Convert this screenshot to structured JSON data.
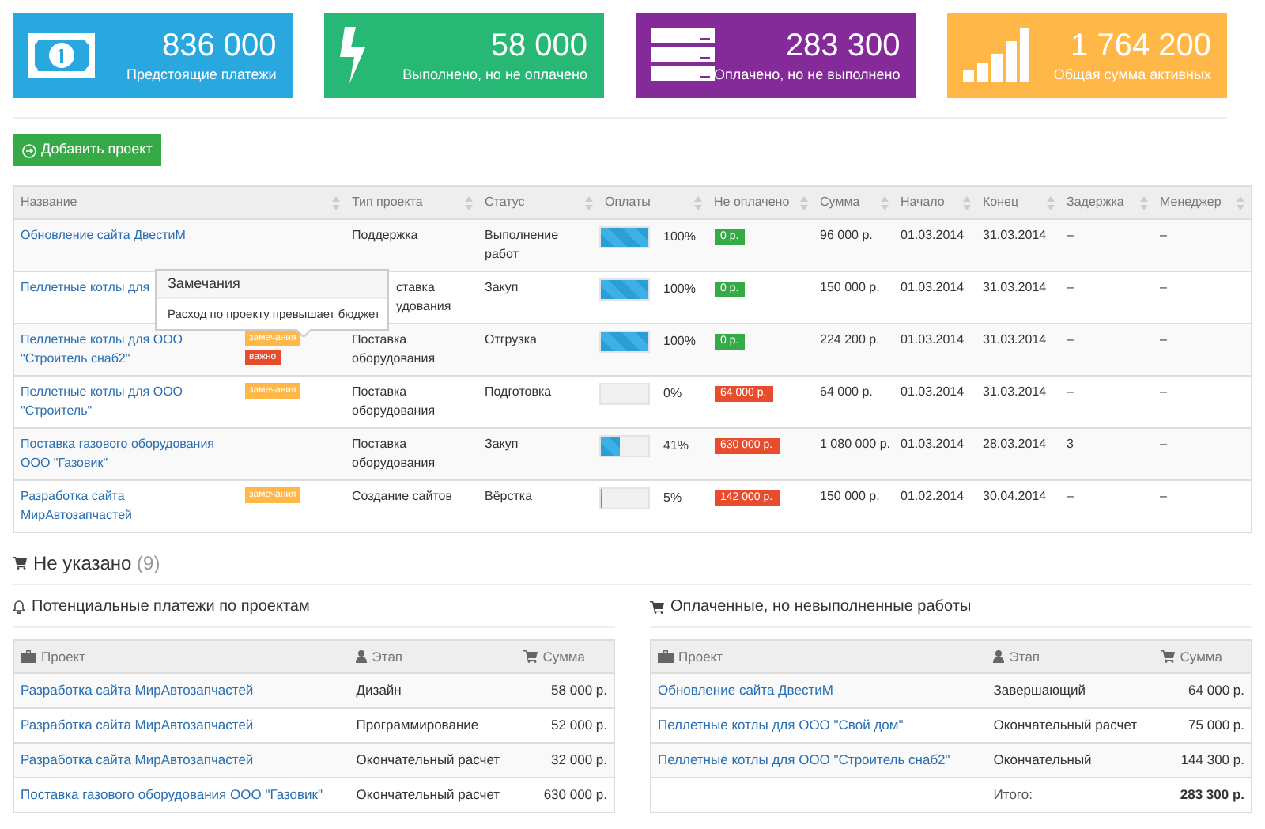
{
  "stats": [
    {
      "kind": "money",
      "color": "#29a8e0",
      "value": "836 000",
      "label": "Предстоящие платежи"
    },
    {
      "kind": "bolt",
      "color": "#27b876",
      "value": "58 000",
      "label": "Выполнено, но не оплачено"
    },
    {
      "kind": "server",
      "color": "#852b99",
      "value": "283 300",
      "label": "Оплачено, но не выполнено"
    },
    {
      "kind": "signal",
      "color": "#ffb848",
      "value": "1 764 200",
      "label": "Общая сумма активных"
    }
  ],
  "add_button": "Добавить проект",
  "table": {
    "columns": [
      "Название",
      "",
      "Тип проекта",
      "Статус",
      "Оплаты",
      "Не оплачено",
      "Сумма",
      "Начало",
      "Конец",
      "Задержка",
      "Менеджер"
    ],
    "rows": [
      {
        "name": "Обновление сайта ДвестиМ",
        "badges": [],
        "type": [
          "Поддержка"
        ],
        "status": [
          "Выполнение",
          "работ"
        ],
        "level": 1,
        "percent": "100%",
        "unpaid": "0 р.",
        "overdue": false,
        "sum": "96 000 р.",
        "start": "01.03.2014",
        "end": "31.03.2014",
        "delay": "–",
        "manager": "–"
      },
      {
        "name": "Пеллетные котлы для",
        "badges": [],
        "type": [
          "ставка",
          "удования"
        ],
        "status": [
          "Закуп"
        ],
        "level": 1,
        "percent": "100%",
        "unpaid": "0 р.",
        "overdue": false,
        "sum": "150 000 р.",
        "start": "01.03.2014",
        "end": "31.03.2014",
        "delay": "–",
        "manager": "–"
      },
      {
        "name": "Пеллетные котлы для ООО \"Строитель снаб2\"",
        "badges": [
          {
            "kind": "note",
            "text": "замечания"
          },
          {
            "kind": "important",
            "text": "важно"
          }
        ],
        "type": [
          "Поставка",
          "оборудования"
        ],
        "status": [
          "Отгрузка"
        ],
        "level": 1,
        "percent": "100%",
        "unpaid": "0 р.",
        "overdue": false,
        "sum": "224 200 р.",
        "start": "01.03.2014",
        "end": "31.03.2014",
        "delay": "–",
        "manager": "–"
      },
      {
        "name": "Пеллетные котлы для ООО \"Строитель\"",
        "badges": [
          {
            "kind": "note",
            "text": "замечания"
          }
        ],
        "type": [
          "Поставка",
          "оборудования"
        ],
        "status": [
          "Подготовка"
        ],
        "level": 0,
        "percent": "0%",
        "unpaid": "64 000 р.",
        "overdue": true,
        "sum": "64 000 р.",
        "start": "01.03.2014",
        "end": "31.03.2014",
        "delay": "–",
        "manager": "–"
      },
      {
        "name": "Поставка газового оборудования ООО \"Газовик\"",
        "badges": [],
        "type": [
          "Поставка",
          "оборудования"
        ],
        "status": [
          "Закуп"
        ],
        "level": 0.41,
        "percent": "41%",
        "unpaid": "630 000 р.",
        "overdue": true,
        "sum": "1 080 000 р.",
        "start": "01.03.2014",
        "end": "28.03.2014",
        "delay": "3",
        "manager": "–"
      },
      {
        "name": "Разработка сайта МирАвтозапчастей",
        "badges": [
          {
            "kind": "note",
            "text": "замечания"
          }
        ],
        "type": [
          "Создание сайтов"
        ],
        "status": [
          "Вёрстка"
        ],
        "level": 0.05,
        "percent": "5%",
        "unpaid": "142 000 р.",
        "overdue": true,
        "sum": "150 000 р.",
        "start": "01.02.2014",
        "end": "30.04.2014",
        "delay": "–",
        "manager": "–"
      }
    ]
  },
  "popover": {
    "title": "Замечания",
    "text": "Расход по проекту превышает бюджет"
  },
  "section": {
    "title": "Не указано",
    "count": "(9)"
  },
  "panels": [
    {
      "title": "Потенциальные платежи по проектам",
      "columns": [
        "Проект",
        "Этап",
        "Сумма"
      ],
      "rows": [
        {
          "project": "Разработка сайта МирАвтозапчастей",
          "stage": "Дизайн",
          "sum": "58 000 р."
        },
        {
          "project": "Разработка сайта МирАвтозапчастей",
          "stage": "Программирование",
          "sum": "52 000 р."
        },
        {
          "project": "Разработка сайта МирАвтозапчастей",
          "stage": "Окончательный расчет",
          "sum": "32 000 р."
        },
        {
          "project": "Поставка газового оборудования ООО \"Газовик\"",
          "stage": "Окончательный расчет",
          "sum": "630 000 р."
        }
      ]
    },
    {
      "title": "Оплаченные, но невыполненные работы",
      "columns": [
        "Проект",
        "Этап",
        "Сумма"
      ],
      "rows": [
        {
          "project": "Обновление сайта ДвестиМ",
          "stage": "Завершающий",
          "sum": "64 000 р."
        },
        {
          "project": "Пеллетные котлы для ООО \"Свой дом\"",
          "stage": "Окончательный расчет",
          "sum": "75 000 р."
        },
        {
          "project": "Пеллетные котлы для ООО \"Строитель снаб2\"",
          "stage": "Окончательный",
          "sum": "144 300 р."
        }
      ],
      "total": {
        "label": "Итого:",
        "sum": "283 300 р."
      }
    }
  ]
}
